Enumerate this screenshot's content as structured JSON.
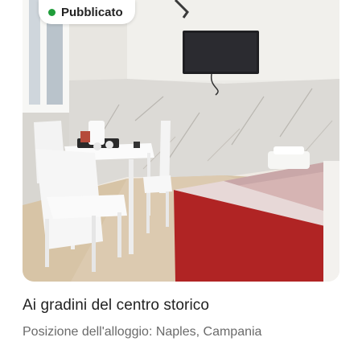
{
  "listing": {
    "status_label": "Pubblicato",
    "status_color": "#1f9d3a",
    "title": "Ai gradini del centro storico",
    "location": "Posizione dell'alloggio: Naples, Campania",
    "photo_icon": "listing-photo"
  }
}
